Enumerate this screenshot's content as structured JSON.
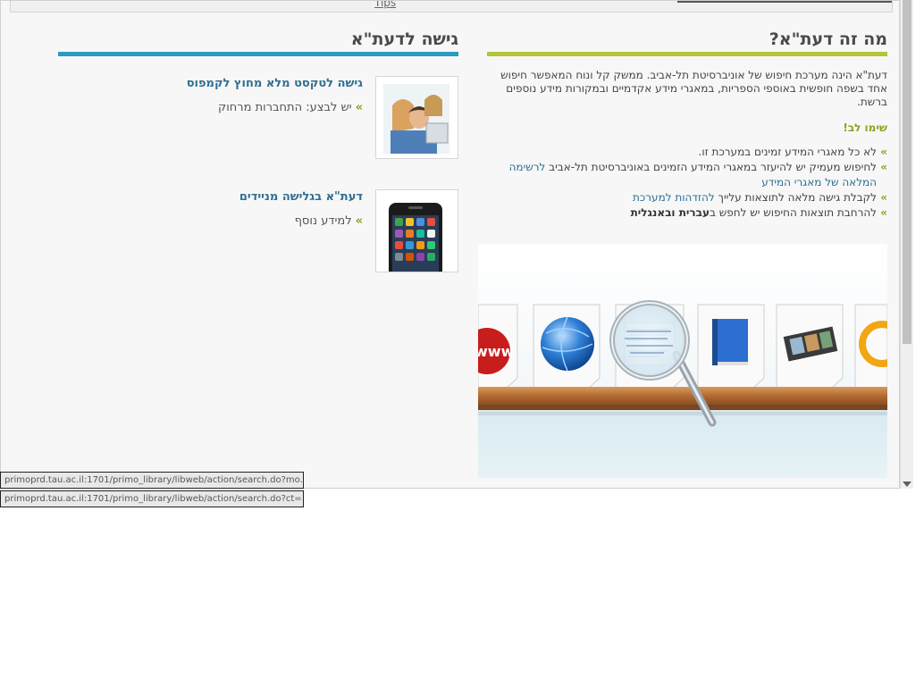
{
  "topbar": {
    "tips_label": "Tips"
  },
  "right_section": {
    "title": "מה זה דעת\"א?",
    "intro": "דעת\"א הינה מערכת חיפוש של אוניברסיטת תל-אביב. ממשק קל ונוח המאפשר חיפוש אחד בשפה חופשית באוספי הספריות, במאגרי מידע אקדמיים ובמקורות מידע נוספים ברשת.",
    "notice": "שימו לב!",
    "items": [
      {
        "text": "לא כל מאגרי המידע זמינים במערכת זו."
      },
      {
        "text": "לחיפוש מעמיק יש להיעזר במאגרי המידע הזמינים באוניברסיטת תל-אביב ",
        "link": "לרשימה המלאה של מאגרי המידע"
      },
      {
        "text": "לקבלת גישה מלאה לתוצאות עלייך ",
        "link": "להזדהות למערכת"
      },
      {
        "text": "להרחבת תוצאות החיפוש יש לחפש ב",
        "bold": "עברית ובאנגלית"
      }
    ]
  },
  "left_section": {
    "title": "גישה לדעת\"א",
    "cards": [
      {
        "title": "גישה לטקסט מלא מחוץ לקמפוס",
        "sub": "יש לבצע: התחברות מרחוק"
      },
      {
        "title": "דעת\"א בגלישה מניידים",
        "sub": "למידע נוסף"
      }
    ]
  },
  "banner": {
    "www_label": "www"
  },
  "status_bars": [
    "primoprd.tau.ac.il:1701/primo_library/libweb/action/search.do?mo...",
    "primoprd.tau.ac.il:1701/primo_library/libweb/action/search.do?ct=..."
  ],
  "colors": {
    "accent_green": "#b5c336",
    "accent_blue": "#2a9bbf",
    "link": "#2f6f92"
  }
}
